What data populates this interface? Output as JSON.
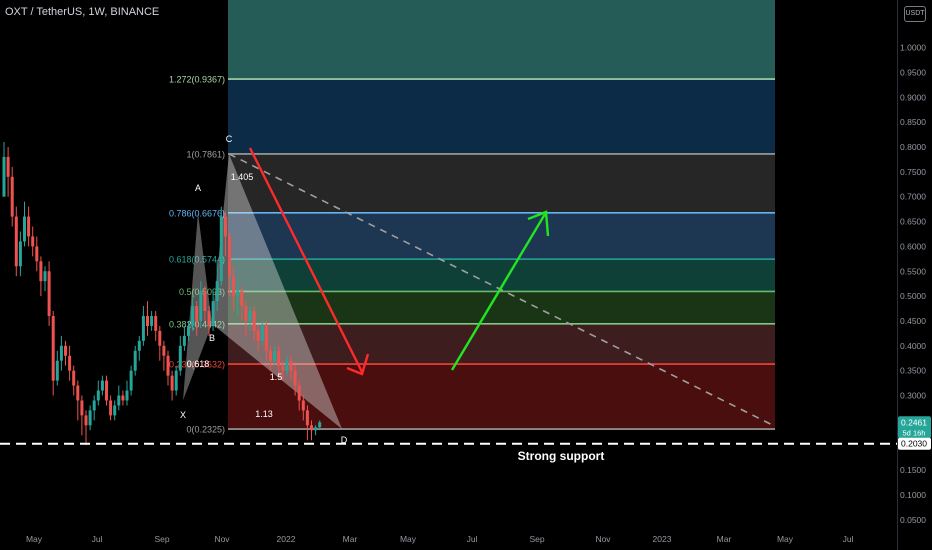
{
  "header": {
    "title": "OXT / TetherUS, 1W, BINANCE",
    "currency": "USDT"
  },
  "colors": {
    "up": "#26a69a",
    "down": "#ef5350",
    "harmonic": "#e0e0e0",
    "arrow_down": "#ff2a2a",
    "arrow_up": "#22e522",
    "support": "#ffffff"
  },
  "chart_data": {
    "type": "candlestick",
    "title": "OXT / TetherUS, 1W, BINANCE",
    "xlabel": "",
    "ylabel": "",
    "ylim": [
      0.03,
      1.1
    ],
    "y_ticks": [
      "1.0000",
      "0.9500",
      "0.9000",
      "0.8500",
      "0.8000",
      "0.7500",
      "0.7000",
      "0.6500",
      "0.6000",
      "0.5500",
      "0.5000",
      "0.4500",
      "0.4000",
      "0.3500",
      "0.3000",
      "0.2500",
      "0.2000",
      "0.1500",
      "0.1000",
      "0.0500"
    ],
    "x_ticks": [
      "May",
      "Jul",
      "Sep",
      "Nov",
      "2022",
      "Mar",
      "May",
      "Jul",
      "Sep",
      "Nov",
      "2023",
      "Mar",
      "May",
      "Jul"
    ],
    "last_price": {
      "value": "0.2461",
      "countdown": "5d 16h"
    },
    "support_level": {
      "value": "0.2030",
      "label": "Strong support"
    },
    "fib_levels": [
      {
        "label": "1.272(0.9367)",
        "value": 0.9367,
        "color": "#a5d6a7"
      },
      {
        "label": "1(0.7861)",
        "value": 0.7861,
        "color": "#9e9e9e"
      },
      {
        "label": "0.786(0.6676)",
        "value": 0.6676,
        "color": "#64b5f6"
      },
      {
        "label": "0.618(0.5744)",
        "value": 0.5744,
        "color": "#26a69a"
      },
      {
        "label": "0.5(0.5093)",
        "value": 0.5093,
        "color": "#66bb6a"
      },
      {
        "label": "0.382(0.4442)",
        "value": 0.4442,
        "color": "#81c784"
      },
      {
        "label": "0.236(0.3632)",
        "value": 0.3632,
        "color": "#f44336"
      },
      {
        "label": "0(0.2325)",
        "value": 0.2325,
        "color": "#9e9e9e"
      }
    ],
    "harmonic_points": [
      {
        "label": "X",
        "value": 0.29
      },
      {
        "label": "A",
        "value": 0.6676
      },
      {
        "label": "B",
        "value": 0.4442
      },
      {
        "label": "C",
        "value": 0.7861
      },
      {
        "label": "D",
        "value": 0.2325
      }
    ],
    "harmonic_ratios": [
      "1.405",
      "0.618",
      "1.5",
      "1.13"
    ],
    "candles": [
      [
        0.7,
        0.78,
        0.74,
        0.81
      ],
      [
        0.78,
        0.74,
        0.7,
        0.8
      ],
      [
        0.74,
        0.66,
        0.64,
        0.76
      ],
      [
        0.66,
        0.56,
        0.54,
        0.68
      ],
      [
        0.56,
        0.61,
        0.54,
        0.63
      ],
      [
        0.61,
        0.66,
        0.6,
        0.69
      ],
      [
        0.66,
        0.62,
        0.6,
        0.68
      ],
      [
        0.62,
        0.6,
        0.58,
        0.64
      ],
      [
        0.6,
        0.57,
        0.55,
        0.62
      ],
      [
        0.57,
        0.53,
        0.5,
        0.58
      ],
      [
        0.53,
        0.55,
        0.51,
        0.56
      ],
      [
        0.55,
        0.46,
        0.44,
        0.57
      ],
      [
        0.46,
        0.33,
        0.3,
        0.47
      ],
      [
        0.33,
        0.37,
        0.32,
        0.39
      ],
      [
        0.37,
        0.4,
        0.35,
        0.42
      ],
      [
        0.4,
        0.38,
        0.36,
        0.41
      ],
      [
        0.38,
        0.35,
        0.33,
        0.4
      ],
      [
        0.35,
        0.32,
        0.3,
        0.36
      ],
      [
        0.32,
        0.29,
        0.25,
        0.33
      ],
      [
        0.29,
        0.26,
        0.22,
        0.3
      ],
      [
        0.26,
        0.24,
        0.2,
        0.27
      ],
      [
        0.24,
        0.27,
        0.23,
        0.28
      ],
      [
        0.27,
        0.29,
        0.25,
        0.3
      ],
      [
        0.29,
        0.31,
        0.28,
        0.33
      ],
      [
        0.31,
        0.33,
        0.3,
        0.34
      ],
      [
        0.33,
        0.29,
        0.28,
        0.34
      ],
      [
        0.29,
        0.26,
        0.25,
        0.3
      ],
      [
        0.26,
        0.28,
        0.25,
        0.29
      ],
      [
        0.28,
        0.3,
        0.27,
        0.32
      ],
      [
        0.3,
        0.29,
        0.28,
        0.31
      ],
      [
        0.29,
        0.31,
        0.28,
        0.33
      ],
      [
        0.31,
        0.35,
        0.3,
        0.36
      ],
      [
        0.35,
        0.39,
        0.34,
        0.4
      ],
      [
        0.39,
        0.41,
        0.37,
        0.42
      ],
      [
        0.41,
        0.46,
        0.4,
        0.48
      ],
      [
        0.46,
        0.44,
        0.42,
        0.49
      ],
      [
        0.44,
        0.46,
        0.43,
        0.47
      ],
      [
        0.46,
        0.43,
        0.41,
        0.47
      ],
      [
        0.43,
        0.4,
        0.37,
        0.44
      ],
      [
        0.4,
        0.38,
        0.35,
        0.41
      ],
      [
        0.38,
        0.34,
        0.32,
        0.39
      ],
      [
        0.34,
        0.31,
        0.29,
        0.35
      ],
      [
        0.31,
        0.35,
        0.3,
        0.36
      ],
      [
        0.35,
        0.4,
        0.34,
        0.42
      ],
      [
        0.4,
        0.42,
        0.39,
        0.44
      ],
      [
        0.42,
        0.44,
        0.41,
        0.45
      ],
      [
        0.44,
        0.48,
        0.43,
        0.5
      ],
      [
        0.48,
        0.45,
        0.42,
        0.49
      ],
      [
        0.45,
        0.51,
        0.44,
        0.53
      ],
      [
        0.51,
        0.47,
        0.45,
        0.52
      ],
      [
        0.47,
        0.44,
        0.42,
        0.48
      ],
      [
        0.44,
        0.49,
        0.43,
        0.51
      ],
      [
        0.49,
        0.53,
        0.47,
        0.57
      ],
      [
        0.53,
        0.66,
        0.52,
        0.68
      ],
      [
        0.66,
        0.62,
        0.58,
        0.67
      ],
      [
        0.62,
        0.54,
        0.5,
        0.63
      ],
      [
        0.54,
        0.5,
        0.47,
        0.56
      ],
      [
        0.5,
        0.51,
        0.46,
        0.53
      ],
      [
        0.51,
        0.48,
        0.45,
        0.52
      ],
      [
        0.48,
        0.45,
        0.42,
        0.49
      ],
      [
        0.45,
        0.47,
        0.43,
        0.48
      ],
      [
        0.47,
        0.43,
        0.41,
        0.48
      ],
      [
        0.43,
        0.41,
        0.39,
        0.44
      ],
      [
        0.41,
        0.44,
        0.4,
        0.45
      ],
      [
        0.44,
        0.39,
        0.37,
        0.45
      ],
      [
        0.39,
        0.37,
        0.35,
        0.4
      ],
      [
        0.37,
        0.39,
        0.36,
        0.4
      ],
      [
        0.39,
        0.36,
        0.34,
        0.4
      ],
      [
        0.36,
        0.35,
        0.33,
        0.37
      ],
      [
        0.35,
        0.37,
        0.34,
        0.38
      ],
      [
        0.37,
        0.35,
        0.33,
        0.38
      ],
      [
        0.35,
        0.32,
        0.3,
        0.36
      ],
      [
        0.32,
        0.29,
        0.27,
        0.33
      ],
      [
        0.29,
        0.27,
        0.25,
        0.3
      ],
      [
        0.27,
        0.24,
        0.21,
        0.28
      ],
      [
        0.24,
        0.23,
        0.21,
        0.25
      ],
      [
        0.23,
        0.236,
        0.22,
        0.24
      ],
      [
        0.236,
        0.2461,
        0.23,
        0.25
      ]
    ]
  }
}
